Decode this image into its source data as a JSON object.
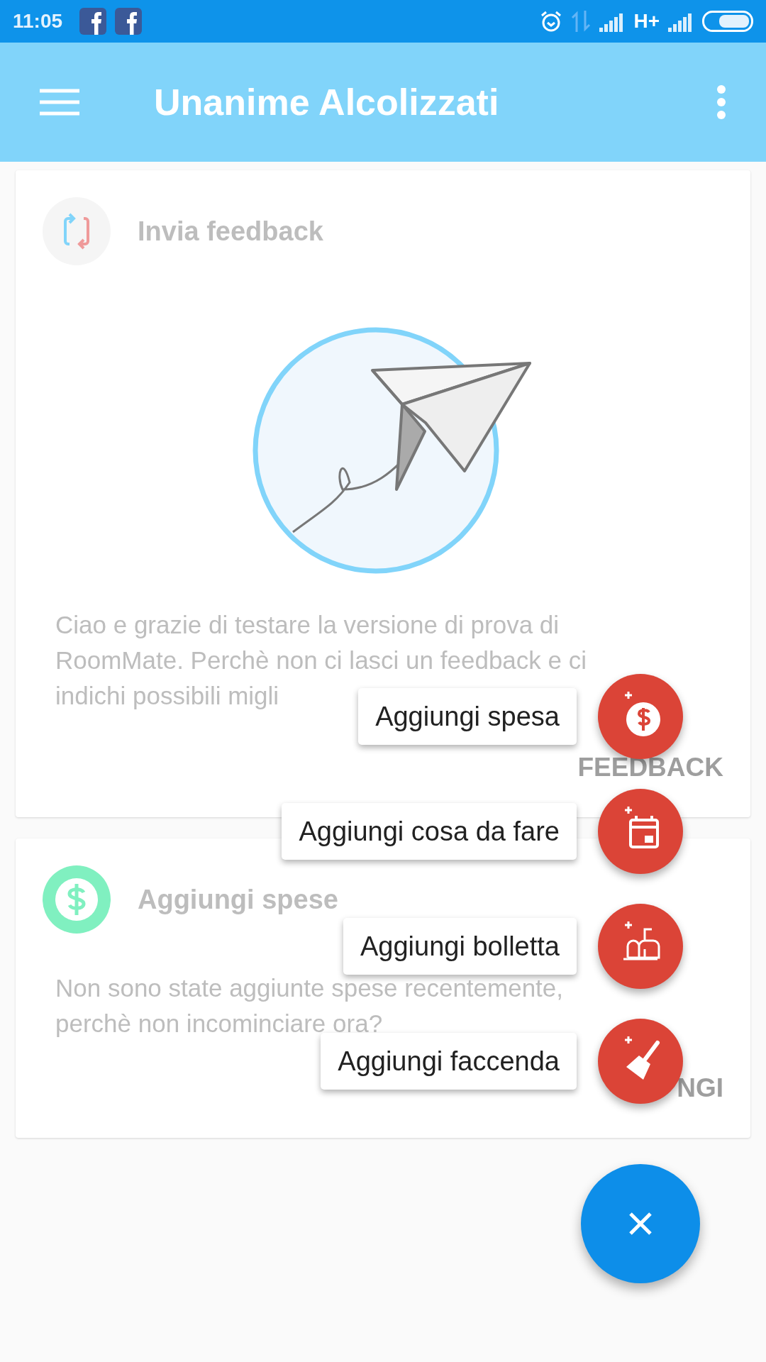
{
  "status_bar": {
    "time": "11:05",
    "network": "H+"
  },
  "app_bar": {
    "title": "Unanime Alcolizzati"
  },
  "cards": [
    {
      "title": "Invia feedback",
      "text": "Ciao e grazie di testare la versione di prova di RoomMate. Perchè non ci lasci un feedback e ci indichi possibili migli",
      "action": "FEEDBACK"
    },
    {
      "title": "Aggiungi spese",
      "text": "Non sono state aggiunte spese recentemente, perchè non incominciare ora?",
      "action": "NGI"
    }
  ],
  "fab_menu": {
    "expanded": true,
    "items": [
      {
        "label": "Aggiungi spesa"
      },
      {
        "label": "Aggiungi cosa da fare"
      },
      {
        "label": "Aggiungi bolletta"
      },
      {
        "label": "Aggiungi faccenda"
      }
    ]
  }
}
